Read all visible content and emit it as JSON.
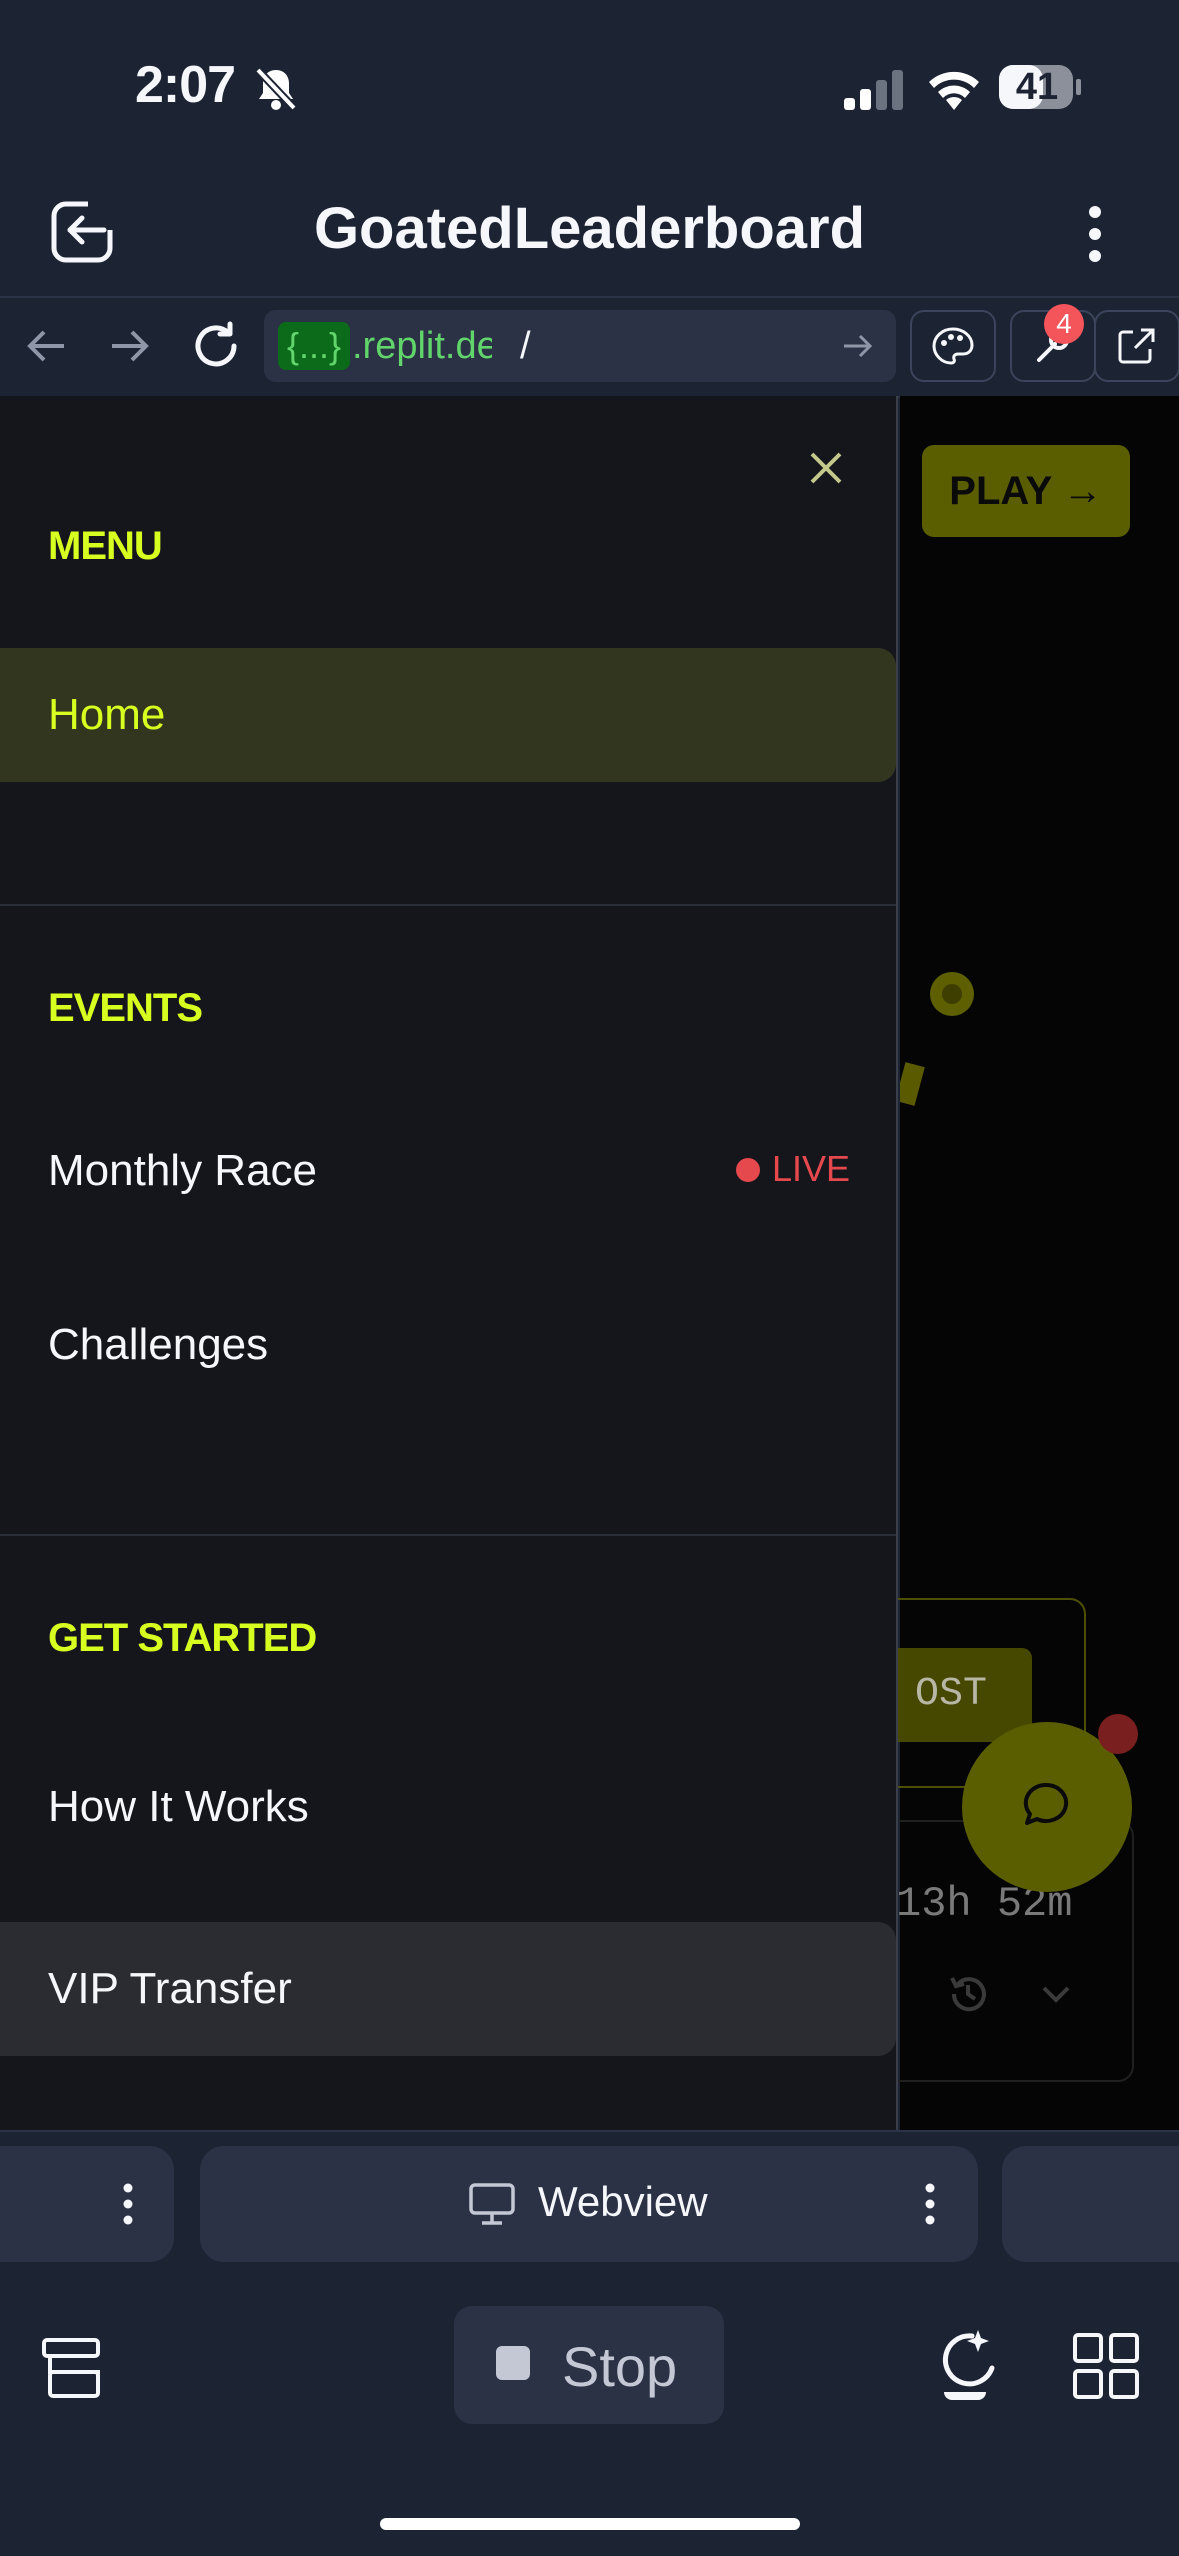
{
  "status_bar": {
    "time": "2:07",
    "battery": "41"
  },
  "app_bar": {
    "title": "GoatedLeaderboard"
  },
  "browser": {
    "url_token": "{...}",
    "url_domain": ".replit.dev",
    "url_path": "/",
    "notification_count": "4"
  },
  "page_behind": {
    "play_label": "PLAY →",
    "boost_label": "OST",
    "timer": "13h 52m"
  },
  "drawer": {
    "menu_title": "MENU",
    "home_label": "Home",
    "events_title": "EVENTS",
    "monthly_race_label": "Monthly Race",
    "live_label": "LIVE",
    "challenges_label": "Challenges",
    "get_started_title": "GET STARTED",
    "how_it_works_label": "How It Works",
    "vip_transfer_label": "VIP Transfer"
  },
  "tabs": {
    "webview_label": "Webview"
  },
  "bottom_bar": {
    "stop_label": "Stop"
  },
  "colors": {
    "accent": "#d7ff1f",
    "live": "#e5484d",
    "background": "#1c2333"
  }
}
